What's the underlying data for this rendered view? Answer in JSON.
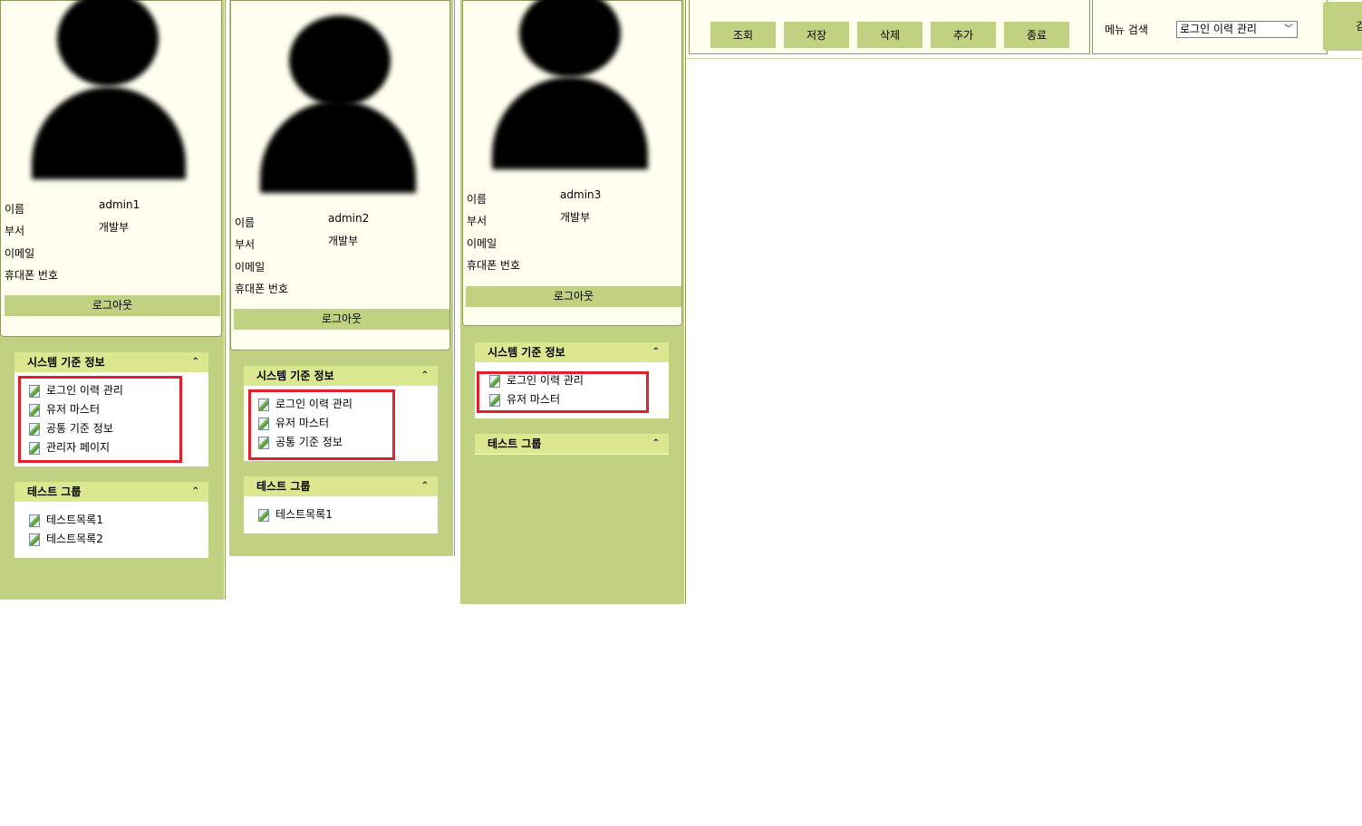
{
  "panels": [
    {
      "user": {
        "name_label": "이름",
        "name": "admin1",
        "dept_label": "부서",
        "dept": "개발부",
        "email_label": "이메일",
        "phone_label": "휴대폰 번호"
      },
      "logout_label": "로그아웃",
      "groups": [
        {
          "title": "시스템 기준 정보",
          "items": [
            "로그인 이력 관리",
            "유저 마스터",
            "공통 기준 정보",
            "관리자 페이지"
          ]
        },
        {
          "title": "테스트 그룹",
          "items": [
            "테스트목록1",
            "테스트목록2"
          ]
        }
      ]
    },
    {
      "user": {
        "name_label": "이름",
        "name": "admin2",
        "dept_label": "부서",
        "dept": "개발부",
        "email_label": "이메일",
        "phone_label": "휴대폰 번호"
      },
      "logout_label": "로그아웃",
      "groups": [
        {
          "title": "시스템 기준 정보",
          "items": [
            "로그인 이력 관리",
            "유저 마스터",
            "공통 기준 정보"
          ]
        },
        {
          "title": "테스트 그룹",
          "items": [
            "테스트목록1"
          ]
        }
      ]
    },
    {
      "user": {
        "name_label": "이름",
        "name": "admin3",
        "dept_label": "부서",
        "dept": "개발부",
        "email_label": "이메일",
        "phone_label": "휴대폰 번호"
      },
      "logout_label": "로그아웃",
      "groups": [
        {
          "title": "시스템 기준 정보",
          "items": [
            "로그인 이력 관리",
            "유저 마스터"
          ]
        },
        {
          "title": "테스트 그룹",
          "items": []
        }
      ]
    }
  ],
  "toolbar": {
    "search": "조회",
    "save": "저장",
    "delete": "삭제",
    "add": "추가",
    "exit": "종료"
  },
  "menu_search": {
    "label": "메뉴 검색",
    "selected": "로그인 이력 관리"
  },
  "right_button_partial": "검",
  "icons": {
    "collapse": "double-chevron-up-icon",
    "menu_item": "document-icon",
    "avatar": "user-silhouette-icon",
    "dropdown": "chevron-down-icon"
  },
  "colors": {
    "accent": "#c0d181",
    "header": "#dce88f",
    "panel_bg": "#fffff0",
    "highlight": "#e0202a"
  }
}
